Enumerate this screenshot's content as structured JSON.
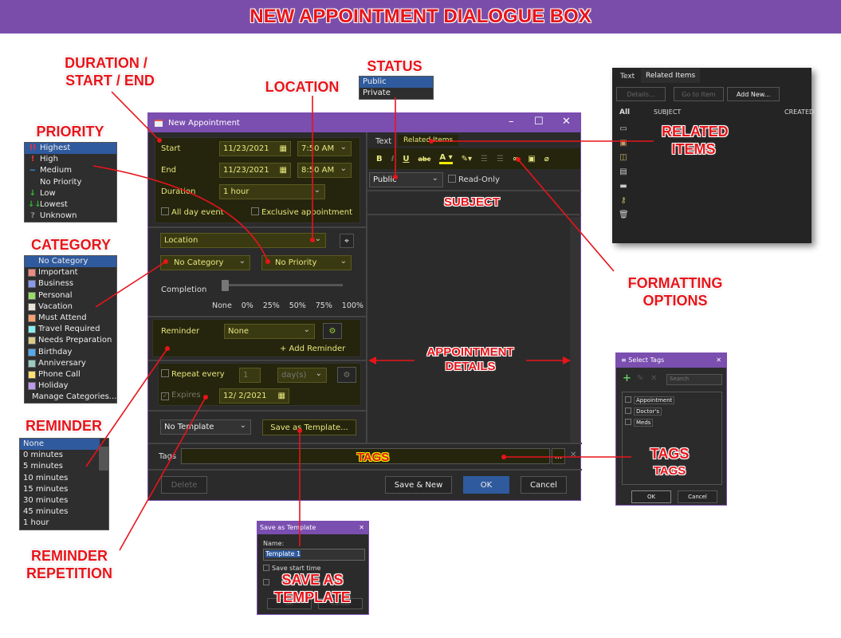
{
  "banner": {
    "title": "NEW APPOINTMENT DIALOGUE BOX"
  },
  "annotations": {
    "duration": "DURATION /",
    "start_end": "START / END",
    "location": "LOCATION",
    "status": "STATUS",
    "priority": "PRIORITY",
    "category": "CATEGORY",
    "reminder": "REMINDER",
    "reminder_rep_1": "REMINDER",
    "reminder_rep_2": "REPETITION",
    "related_1": "RELATED",
    "related_2": "ITEMS",
    "formatting_1": "FORMATTING",
    "formatting_2": "OPTIONS",
    "subject": "SUBJECT",
    "details_1": "APPOINTMENT",
    "details_2": "DETAILS",
    "tags_field": "TAGS",
    "tags": "TAGS",
    "tags_dialog": "TAGS",
    "save_template_1": "SAVE AS",
    "save_template_2": "TEMPLATE"
  },
  "dialog": {
    "title": "New Appointment",
    "start_label": "Start",
    "start_date": "11/23/2021",
    "start_time": "7:50 AM",
    "end_label": "End",
    "end_date": "11/23/2021",
    "end_time": "8:50 AM",
    "duration_label": "Duration",
    "duration": "1 hour",
    "all_day": "All day event",
    "exclusive": "Exclusive appointment",
    "location": "Location",
    "category": "No Category",
    "priority": "No Priority",
    "completion_label": "Completion",
    "completion_value": 0,
    "completion_ticks": [
      "None",
      "0%",
      "25%",
      "50%",
      "75%",
      "100%"
    ],
    "reminder_label": "Reminder",
    "reminder": "None",
    "add_reminder": "+ Add Reminder",
    "repeat_label": "Repeat every",
    "repeat_count": "1",
    "repeat_unit": "day(s)",
    "expires_label": "Expires",
    "expires_date": "12/ 2/2021",
    "template": "No Template",
    "save_template": "Save as Template...",
    "tabs": [
      "Text",
      "Related Items"
    ],
    "format_buttons": [
      "B",
      "I",
      "U",
      "abc"
    ],
    "status": "Public",
    "read_only": "Read-Only",
    "tags_label": "Tags",
    "tags_more": "...",
    "delete": "Delete",
    "save_new": "Save & New",
    "ok": "OK",
    "cancel": "Cancel",
    "accent": "#7a4fb0"
  },
  "status_list": {
    "items": [
      "Public",
      "Private"
    ],
    "selected": "Public"
  },
  "priority_list": {
    "items": [
      {
        "icon": "!!",
        "color": "#e33",
        "label": "Highest"
      },
      {
        "icon": "!",
        "color": "#e33",
        "label": "High"
      },
      {
        "icon": "~",
        "color": "#39f",
        "label": "Medium"
      },
      {
        "icon": "",
        "color": "",
        "label": "No Priority"
      },
      {
        "icon": "↓",
        "color": "#3b3",
        "label": "Low"
      },
      {
        "icon": "↓↓",
        "color": "#3b3",
        "label": "Lowest"
      },
      {
        "icon": "?",
        "color": "#888",
        "label": "Unknown"
      }
    ],
    "selected": "Highest"
  },
  "category_list": {
    "items": [
      {
        "label": "No Category",
        "color": ""
      },
      {
        "label": "Important",
        "color": "#f08a80"
      },
      {
        "label": "Business",
        "color": "#8899ee"
      },
      {
        "label": "Personal",
        "color": "#99dd66"
      },
      {
        "label": "Vacation",
        "color": "#e8e4d8"
      },
      {
        "label": "Must Attend",
        "color": "#f5a070"
      },
      {
        "label": "Travel Required",
        "color": "#88eef0"
      },
      {
        "label": "Needs Preparation",
        "color": "#d8cc88"
      },
      {
        "label": "Birthday",
        "color": "#55aaee"
      },
      {
        "label": "Anniversary",
        "color": "#99ccc0"
      },
      {
        "label": "Phone Call",
        "color": "#ffe070"
      },
      {
        "label": "Holiday",
        "color": "#bb99ee"
      },
      {
        "label": "Manage Categories...",
        "color": ""
      }
    ],
    "selected": "No Category"
  },
  "reminder_list": {
    "items": [
      "None",
      "0 minutes",
      "5 minutes",
      "10 minutes",
      "15 minutes",
      "30 minutes",
      "45 minutes",
      "1 hour"
    ],
    "selected": "None"
  },
  "related_panel": {
    "tabs": [
      "Text",
      "Related Items"
    ],
    "buttons": [
      "Details...",
      "Go to Item",
      "Add New..."
    ],
    "filter_all": "All",
    "columns": [
      "SUBJECT",
      "CREATED"
    ]
  },
  "select_tags": {
    "title": "Select Tags",
    "search_placeholder": "Search",
    "tags": [
      "Appointment",
      "Doctor's",
      "Meds"
    ],
    "ok": "OK",
    "cancel": "Cancel"
  },
  "save_template_dialog": {
    "title": "Save as Template",
    "name_label": "Name:",
    "name_value": "Template 1",
    "save_start": "Save start time",
    "ok": "OK",
    "cancel": "Cancel"
  }
}
